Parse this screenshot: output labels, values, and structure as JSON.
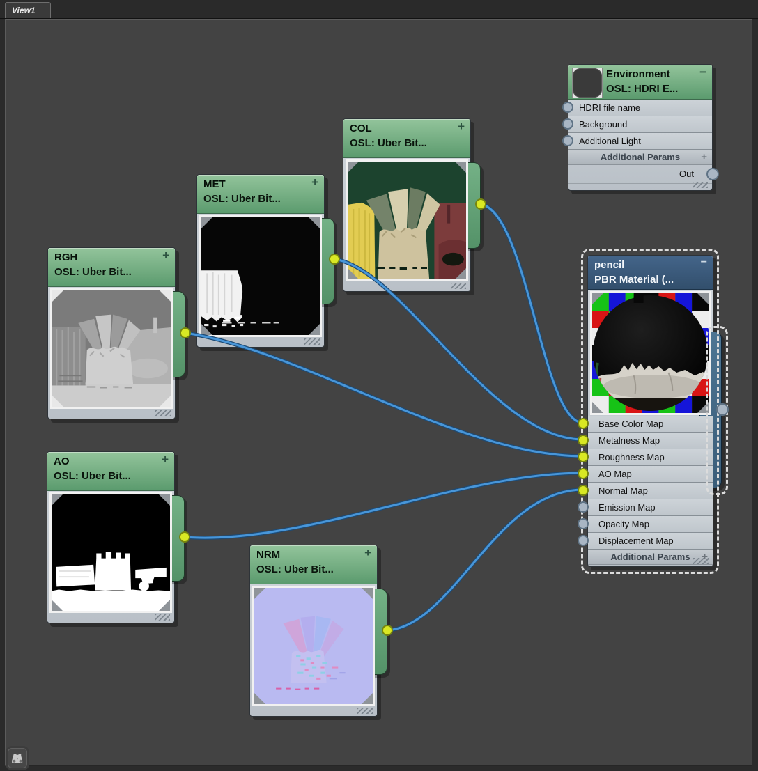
{
  "view_tab": {
    "label": "View1"
  },
  "icons": {
    "expand": "+",
    "collapse": "−",
    "params_add": "+",
    "find": "binoculars"
  },
  "nodes": {
    "environment": {
      "title": "Environment",
      "subtitle": "OSL: HDRI E...",
      "inputs": [
        "HDRI file name",
        "Background",
        "Additional Light"
      ],
      "params_label": "Additional Params",
      "out_label": "Out",
      "output_connected": false
    },
    "col": {
      "title": "COL",
      "subtitle": "OSL: Uber Bit...",
      "map_type": "base color",
      "output_connected": true
    },
    "met": {
      "title": "MET",
      "subtitle": "OSL: Uber Bit...",
      "map_type": "metalness",
      "output_connected": true
    },
    "rgh": {
      "title": "RGH",
      "subtitle": "OSL: Uber Bit...",
      "map_type": "roughness",
      "output_connected": true
    },
    "ao": {
      "title": "AO",
      "subtitle": "OSL: Uber Bit...",
      "map_type": "ambient occlusion",
      "output_connected": true
    },
    "nrm": {
      "title": "NRM",
      "subtitle": "OSL: Uber Bit...",
      "map_type": "normal",
      "output_connected": true
    },
    "pencil": {
      "title": "pencil",
      "subtitle": "PBR Material (...",
      "selected": true,
      "inputs": [
        {
          "label": "Base Color Map",
          "connected": true
        },
        {
          "label": "Metalness Map",
          "connected": true
        },
        {
          "label": "Roughness Map",
          "connected": true
        },
        {
          "label": "AO Map",
          "connected": true
        },
        {
          "label": "Normal Map",
          "connected": true
        },
        {
          "label": "Emission Map",
          "connected": false
        },
        {
          "label": "Opacity Map",
          "connected": false
        },
        {
          "label": "Displacement Map",
          "connected": false
        }
      ],
      "params_label": "Additional Params"
    }
  },
  "connections": [
    {
      "from": "COL",
      "to": "Base Color Map"
    },
    {
      "from": "MET",
      "to": "Metalness Map"
    },
    {
      "from": "RGH",
      "to": "Roughness Map"
    },
    {
      "from": "AO",
      "to": "AO Map"
    },
    {
      "from": "NRM",
      "to": "Normal Map"
    }
  ],
  "colors": {
    "canvas_bg": "#434343",
    "texture_header_green": "#6ba97c",
    "material_header_blue": "#3b5a77",
    "node_body": "#c5ccd2",
    "wire_blue": "#4896d9",
    "socket_connected": "#d9e824",
    "socket_unconnected": "#a9b6c4"
  }
}
